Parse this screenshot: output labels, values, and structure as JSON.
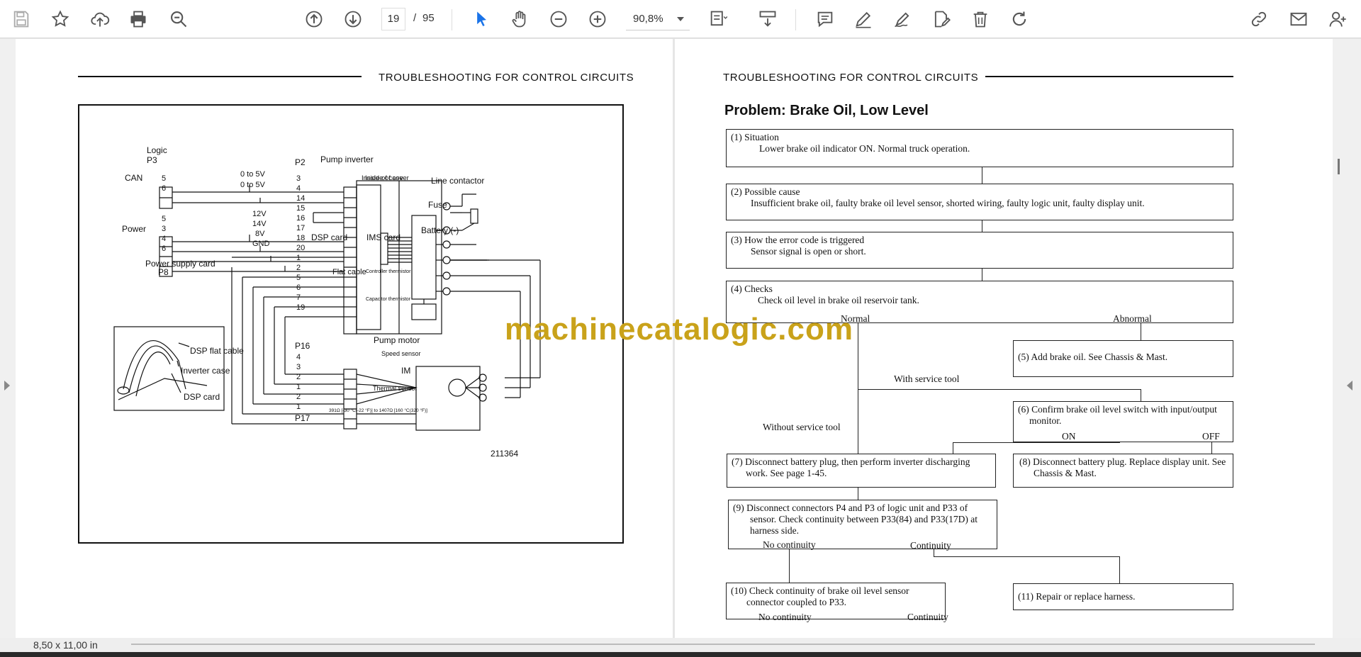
{
  "toolbar": {
    "page_current": "19",
    "page_separator": "/",
    "page_total": "95",
    "zoom": "90,8%",
    "icons": [
      "save-icon",
      "star-icon",
      "upload-icon",
      "print-icon",
      "zoom-out-search-icon",
      "page-up-icon",
      "page-down-icon",
      "select-cursor-icon",
      "hand-icon",
      "zoom-minus-icon",
      "zoom-plus-icon",
      "fit-page-icon",
      "scroll-mode-icon",
      "comment-icon",
      "pen-icon",
      "sign-icon",
      "edit-document-icon",
      "delete-icon",
      "rotate-icon",
      "share-icon",
      "email-icon",
      "add-user-icon"
    ],
    "accent": "#1a73e8"
  },
  "status": {
    "page_size": "8,50 x 11,00 in"
  },
  "watermark": "machinecatalogic.com",
  "left_page": {
    "header": "TROUBLESHOOTING FOR CONTROL CIRCUITS",
    "figure_number": "211364",
    "labels": {
      "logic": "Logic",
      "p3": "P3",
      "can": "CAN",
      "power": "Power",
      "p2": "P2",
      "pump_inverter": "Pump inverter",
      "line_contactor": "Line contactor",
      "fuse": "Fuse",
      "battery": "Battery (-)",
      "power_supply_card": "Power supply card",
      "p8": "P8",
      "inside_cover": "Inside of cover",
      "inside_case": "Inside of case",
      "dsp_card": "DSP card",
      "ims_card": "IMS card",
      "flat_cable": "Flat cable",
      "controller_thermistor": "Controller thermistor",
      "capacitor_thermistor": "Capacitor thermistor",
      "pump_motor": "Pump motor",
      "speed_sensor": "Speed sensor",
      "thermal_sensor": "Thermal sensor",
      "thermal_spec": "391Ω [-30 °C(-22 °F)] to 1407Ω [160 °C(320 °F)]",
      "im": "IM",
      "p16": "P16",
      "p17": "P17",
      "dsp_flat_cable": "DSP flat cable",
      "inverter_case": "Inverter case",
      "dsp_card_inset": "DSP card",
      "v_0_5a": "0 to 5V",
      "v_0_5b": "0 to 5V",
      "v_12": "12V",
      "v_14": "14V",
      "v_8": "8V",
      "gnd": "GND"
    }
  },
  "right_page": {
    "header": "TROUBLESHOOTING FOR CONTROL CIRCUITS",
    "title": "Problem: Brake Oil, Low Level",
    "box1_title": "(1) Situation",
    "box1_text": "Lower brake oil indicator ON. Normal truck operation.",
    "box2_title": "(2) Possible cause",
    "box2_text": "Insufficient brake oil, faulty brake oil level sensor, shorted wiring, faulty logic unit, faulty display unit.",
    "box3_title": "(3) How the error code is triggered",
    "box3_text": "Sensor signal is open or short.",
    "box4_title": "(4) Checks",
    "box4_text": "Check oil level in brake oil reservoir tank.",
    "normal": "Normal",
    "abnormal": "Abnormal",
    "box5": "(5) Add brake oil. See Chassis & Mast.",
    "with_tool": "With service tool",
    "without_tool": "Without service tool",
    "box6": "(6) Confirm brake oil level switch with input/output monitor.",
    "on": "ON",
    "off": "OFF",
    "box7": "(7) Disconnect battery plug, then perform inverter discharging work. See page 1-45.",
    "box8": "(8) Disconnect battery plug. Replace display unit. See Chassis & Mast.",
    "box9": "(9) Disconnect connectors P4 and P3 of logic unit and P33 of sensor. Check continuity between P33(84) and P33(17D) at harness side.",
    "no_continuity_1": "No continuity",
    "continuity_1": "Continuity",
    "box10": "(10) Check continuity of brake oil level sensor connector coupled to P33.",
    "box11": "(11) Repair or replace harness.",
    "no_continuity_2": "No continuity",
    "continuity_2": "Continuity"
  }
}
